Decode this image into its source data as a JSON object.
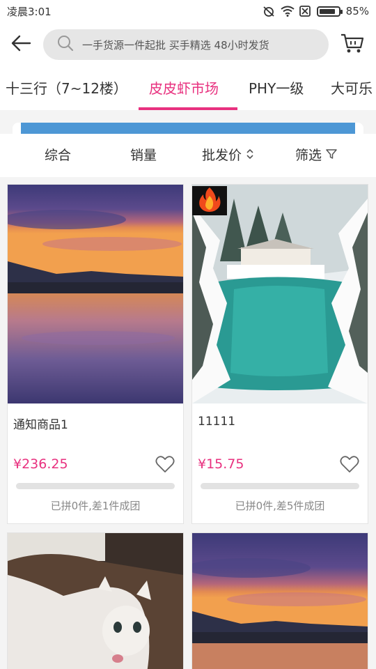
{
  "status": {
    "time": "凌晨3:01",
    "battery": "85%",
    "battery_level": 0.85
  },
  "header": {
    "search_placeholder": "一手货源一件起批 买手精选 48小时发货"
  },
  "tabs": [
    {
      "label": "十三行（7~12楼）",
      "active": false
    },
    {
      "label": "皮皮虾市场",
      "active": true
    },
    {
      "label": "PHY一级",
      "active": false
    },
    {
      "label": "大可乐",
      "active": false
    }
  ],
  "sort": {
    "comprehensive": "综合",
    "sales": "销量",
    "wholesale_price": "批发价",
    "filter": "筛选"
  },
  "products": [
    {
      "title": "通知商品1",
      "price": "¥236.25",
      "group_status": "已拼0件,差1件成团",
      "image": "sunset-lake",
      "hot_badge": false
    },
    {
      "title": "11111",
      "price": "¥15.75",
      "group_status": "已拼0件,差5件成团",
      "image": "snowy-lake",
      "hot_badge": true
    },
    {
      "title": "",
      "price": "",
      "group_status": "",
      "image": "white-cat",
      "hot_badge": false
    },
    {
      "title": "",
      "price": "",
      "group_status": "",
      "image": "sunset-lake",
      "hot_badge": false
    }
  ],
  "colors": {
    "accent": "#e8317f",
    "banner": "#4d97d5"
  }
}
